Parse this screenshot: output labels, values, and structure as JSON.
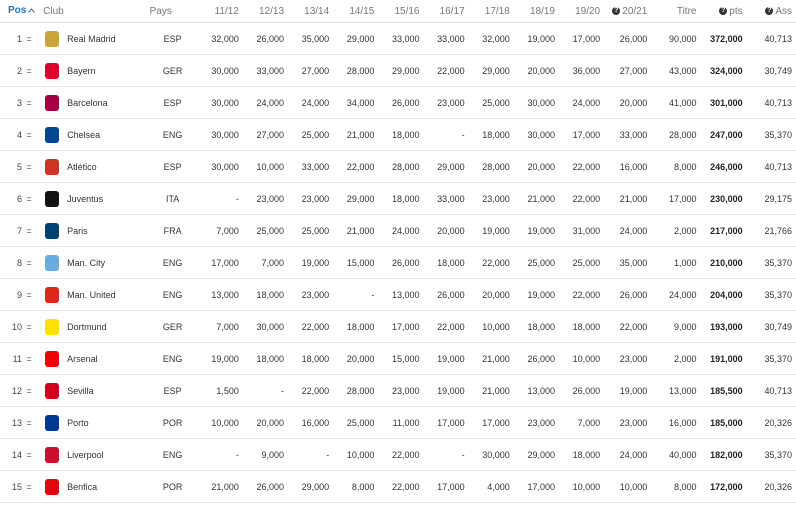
{
  "header": {
    "pos": "Pos",
    "club": "Club",
    "pays": "Pays",
    "seasons": [
      "11/12",
      "12/13",
      "13/14",
      "14/15",
      "15/16",
      "16/17",
      "17/18",
      "18/19",
      "19/20",
      "20/21"
    ],
    "titre": "Titre",
    "pts": "pts",
    "ass": "Ass"
  },
  "rows": [
    {
      "pos": "1",
      "chg": "=",
      "club": "Real Madrid",
      "pays": "ESP",
      "v": [
        "32,000",
        "26,000",
        "35,000",
        "29,000",
        "33,000",
        "33,000",
        "32,000",
        "19,000",
        "17,000",
        "26,000"
      ],
      "titre": "90,000",
      "pts": "372,000",
      "ass": "40,713",
      "logo": "#c9a43a"
    },
    {
      "pos": "2",
      "chg": "=",
      "club": "Bayern",
      "pays": "GER",
      "v": [
        "30,000",
        "33,000",
        "27,000",
        "28,000",
        "29,000",
        "22,000",
        "29,000",
        "20,000",
        "36,000",
        "27,000"
      ],
      "titre": "43,000",
      "pts": "324,000",
      "ass": "30,749",
      "logo": "#dc052d"
    },
    {
      "pos": "3",
      "chg": "=",
      "club": "Barcelona",
      "pays": "ESP",
      "v": [
        "30,000",
        "24,000",
        "24,000",
        "34,000",
        "26,000",
        "23,000",
        "25,000",
        "30,000",
        "24,000",
        "20,000"
      ],
      "titre": "41,000",
      "pts": "301,000",
      "ass": "40,713",
      "logo": "#a50044"
    },
    {
      "pos": "4",
      "chg": "=",
      "club": "Chelsea",
      "pays": "ENG",
      "v": [
        "30,000",
        "27,000",
        "25,000",
        "21,000",
        "18,000",
        "-",
        "18,000",
        "30,000",
        "17,000",
        "33,000"
      ],
      "titre": "28,000",
      "pts": "247,000",
      "ass": "35,370",
      "logo": "#034694"
    },
    {
      "pos": "5",
      "chg": "=",
      "club": "Atlético",
      "pays": "ESP",
      "v": [
        "30,000",
        "10,000",
        "33,000",
        "22,000",
        "28,000",
        "29,000",
        "28,000",
        "20,000",
        "22,000",
        "16,000"
      ],
      "titre": "8,000",
      "pts": "246,000",
      "ass": "40,713",
      "logo": "#cb3524"
    },
    {
      "pos": "6",
      "chg": "=",
      "club": "Juventus",
      "pays": "ITA",
      "v": [
        "-",
        "23,000",
        "23,000",
        "29,000",
        "18,000",
        "33,000",
        "23,000",
        "21,000",
        "22,000",
        "21,000"
      ],
      "titre": "17,000",
      "pts": "230,000",
      "ass": "29,175",
      "logo": "#111111"
    },
    {
      "pos": "7",
      "chg": "=",
      "club": "Paris",
      "pays": "FRA",
      "v": [
        "7,000",
        "25,000",
        "25,000",
        "21,000",
        "24,000",
        "20,000",
        "19,000",
        "19,000",
        "31,000",
        "24,000"
      ],
      "titre": "2,000",
      "pts": "217,000",
      "ass": "21,766",
      "logo": "#004170"
    },
    {
      "pos": "8",
      "chg": "=",
      "club": "Man. City",
      "pays": "ENG",
      "v": [
        "17,000",
        "7,000",
        "19,000",
        "15,000",
        "26,000",
        "18,000",
        "22,000",
        "25,000",
        "25,000",
        "35,000"
      ],
      "titre": "1,000",
      "pts": "210,000",
      "ass": "35,370",
      "logo": "#6cabdd"
    },
    {
      "pos": "9",
      "chg": "=",
      "club": "Man. United",
      "pays": "ENG",
      "v": [
        "13,000",
        "18,000",
        "23,000",
        "-",
        "13,000",
        "26,000",
        "20,000",
        "19,000",
        "22,000",
        "26,000"
      ],
      "titre": "24,000",
      "pts": "204,000",
      "ass": "35,370",
      "logo": "#da291c"
    },
    {
      "pos": "10",
      "chg": "=",
      "club": "Dortmund",
      "pays": "GER",
      "v": [
        "7,000",
        "30,000",
        "22,000",
        "18,000",
        "17,000",
        "22,000",
        "10,000",
        "18,000",
        "18,000",
        "22,000"
      ],
      "titre": "9,000",
      "pts": "193,000",
      "ass": "30,749",
      "logo": "#fde100"
    },
    {
      "pos": "11",
      "chg": "=",
      "club": "Arsenal",
      "pays": "ENG",
      "v": [
        "19,000",
        "18,000",
        "18,000",
        "20,000",
        "15,000",
        "19,000",
        "21,000",
        "26,000",
        "10,000",
        "23,000"
      ],
      "titre": "2,000",
      "pts": "191,000",
      "ass": "35,370",
      "logo": "#ef0107"
    },
    {
      "pos": "12",
      "chg": "=",
      "club": "Sevilla",
      "pays": "ESP",
      "v": [
        "1,500",
        "-",
        "22,000",
        "28,000",
        "23,000",
        "19,000",
        "21,000",
        "13,000",
        "26,000",
        "19,000"
      ],
      "titre": "13,000",
      "pts": "185,500",
      "ass": "40,713",
      "logo": "#d4001f"
    },
    {
      "pos": "13",
      "chg": "=",
      "club": "Porto",
      "pays": "POR",
      "v": [
        "10,000",
        "20,000",
        "16,000",
        "25,000",
        "11,000",
        "17,000",
        "17,000",
        "23,000",
        "7,000",
        "23,000"
      ],
      "titre": "16,000",
      "pts": "185,000",
      "ass": "20,326",
      "logo": "#003893"
    },
    {
      "pos": "14",
      "chg": "=",
      "club": "Liverpool",
      "pays": "ENG",
      "v": [
        "-",
        "9,000",
        "-",
        "10,000",
        "22,000",
        "-",
        "30,000",
        "29,000",
        "18,000",
        "24,000"
      ],
      "titre": "40,000",
      "pts": "182,000",
      "ass": "35,370",
      "logo": "#c8102e"
    },
    {
      "pos": "15",
      "chg": "=",
      "club": "Benfica",
      "pays": "POR",
      "v": [
        "21,000",
        "26,000",
        "29,000",
        "8,000",
        "22,000",
        "17,000",
        "4,000",
        "17,000",
        "10,000",
        "10,000"
      ],
      "titre": "8,000",
      "pts": "172,000",
      "ass": "20,326",
      "logo": "#e20613"
    }
  ]
}
